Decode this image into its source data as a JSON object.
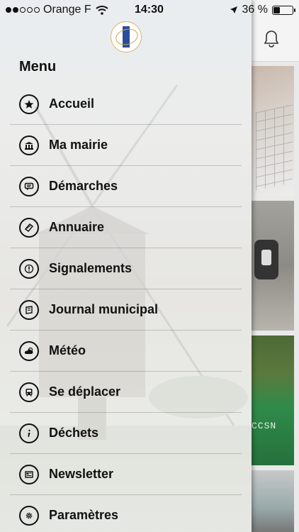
{
  "status_bar": {
    "carrier": "Orange F",
    "time": "14:30",
    "battery_text": "36 %",
    "signal_bars_on": 2,
    "signal_bars_total": 5
  },
  "drawer": {
    "title": "Menu",
    "items": [
      {
        "label": "Accueil",
        "icon": "star-icon"
      },
      {
        "label": "Ma mairie",
        "icon": "town-hall-icon"
      },
      {
        "label": "Démarches",
        "icon": "chat-bubble-icon"
      },
      {
        "label": "Annuaire",
        "icon": "book-icon"
      },
      {
        "label": "Signalements",
        "icon": "alert-icon"
      },
      {
        "label": "Journal municipal",
        "icon": "newspaper-icon"
      },
      {
        "label": "Météo",
        "icon": "weather-icon"
      },
      {
        "label": "Se déplacer",
        "icon": "bus-icon"
      },
      {
        "label": "Déchets",
        "icon": "info-icon"
      },
      {
        "label": "Newsletter",
        "icon": "newsletter-icon"
      },
      {
        "label": "Paramètres",
        "icon": "gear-icon"
      }
    ]
  },
  "background_app": {
    "tile3_text": "CCSN"
  }
}
